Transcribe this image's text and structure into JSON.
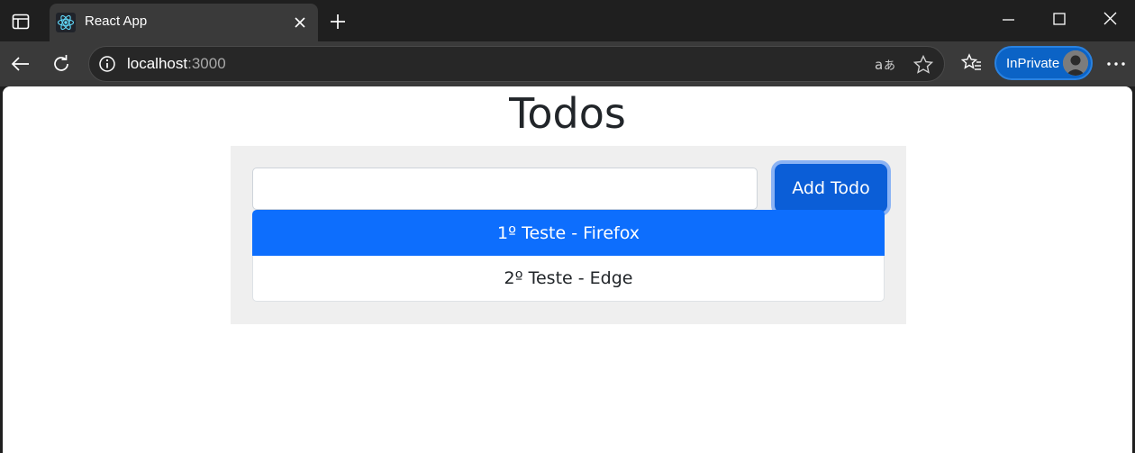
{
  "browser": {
    "tab": {
      "title": "React App",
      "favicon": "react-logo-icon"
    },
    "address": {
      "host": "localhost",
      "port": ":3000"
    },
    "profile_label": "InPrivate",
    "icons": [
      "tab-actions-icon",
      "close-icon",
      "new-tab-icon",
      "minimize-icon",
      "maximize-icon",
      "window-close-icon",
      "back-icon",
      "refresh-icon",
      "info-icon",
      "read-aloud-icon",
      "star-icon",
      "favorites-icon",
      "avatar",
      "more-icon"
    ]
  },
  "page": {
    "title": "Todos",
    "input": {
      "value": "",
      "placeholder": ""
    },
    "add_button": "Add Todo",
    "todos": [
      {
        "label": "1º Teste - Firefox",
        "active": true
      },
      {
        "label": "2º Teste - Edge",
        "active": false
      }
    ]
  },
  "colors": {
    "primary": "#0d6efd",
    "panel": "#efefef",
    "inprivate": "#0b63c6"
  }
}
